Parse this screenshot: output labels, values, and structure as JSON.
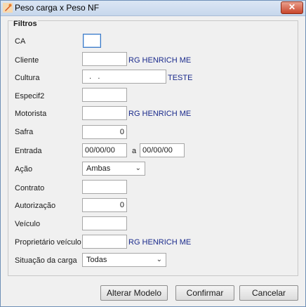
{
  "window": {
    "title": "Peso carga x Peso NF",
    "close_glyph": "✕"
  },
  "filters": {
    "group_title": "Filtros",
    "ca": {
      "label": "CA",
      "value": ""
    },
    "cliente": {
      "label": "Cliente",
      "value": "",
      "name": "RG HENRICH ME"
    },
    "cultura": {
      "label": "Cultura",
      "value": "  .   .",
      "name": "TESTE"
    },
    "especif2": {
      "label": "Especif2",
      "value": ""
    },
    "motorista": {
      "label": "Motorista",
      "value": "",
      "name": "RG HENRICH ME"
    },
    "safra": {
      "label": "Safra",
      "value": "0"
    },
    "entrada": {
      "label": "Entrada",
      "from": "00/00/00",
      "sep": "a",
      "to": "00/00/00"
    },
    "acao": {
      "label": "Ação",
      "selected": "Ambas"
    },
    "contrato": {
      "label": "Contrato",
      "value": ""
    },
    "autorizacao": {
      "label": "Autorização",
      "value": "0"
    },
    "veiculo": {
      "label": "Veículo",
      "value": ""
    },
    "proprietario": {
      "label": "Proprietário veículo",
      "value": "",
      "name": "RG HENRICH ME"
    },
    "situacao": {
      "label": "Situação da carga",
      "selected": "Todas"
    }
  },
  "buttons": {
    "alterar": "Alterar Modelo",
    "confirmar": "Confirmar",
    "cancelar": "Cancelar"
  },
  "icons": {
    "app": "tool-icon",
    "chevron": "chevron-down-icon"
  }
}
